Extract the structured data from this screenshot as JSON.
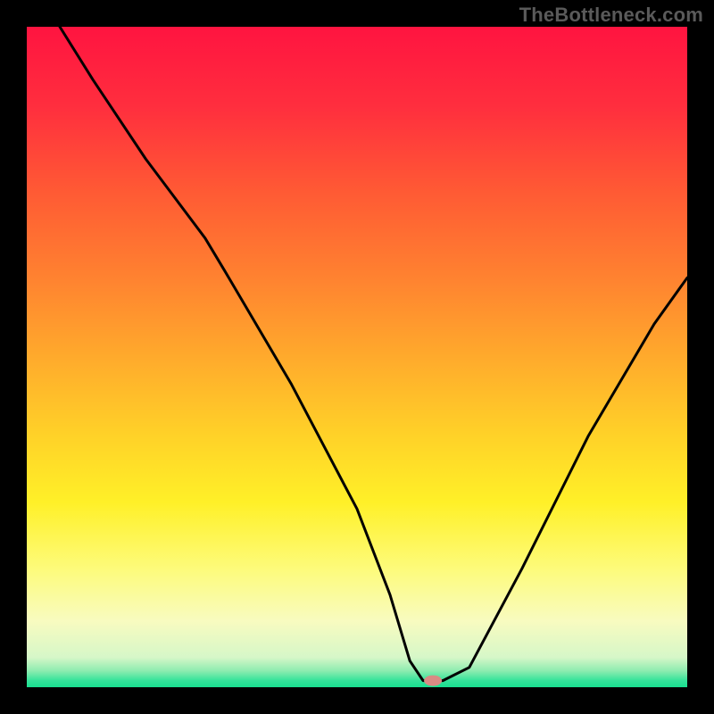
{
  "watermark": "TheBottleneck.com",
  "chart_data": {
    "type": "line",
    "title": "",
    "xlabel": "",
    "ylabel": "",
    "xlim": [
      0,
      100
    ],
    "ylim": [
      0,
      100
    ],
    "grid": false,
    "legend": false,
    "background_gradient": {
      "stops": [
        {
          "offset": 0.0,
          "color": "#ff1440"
        },
        {
          "offset": 0.12,
          "color": "#ff2e3e"
        },
        {
          "offset": 0.25,
          "color": "#ff5a34"
        },
        {
          "offset": 0.38,
          "color": "#ff8230"
        },
        {
          "offset": 0.5,
          "color": "#ffaa2c"
        },
        {
          "offset": 0.62,
          "color": "#ffd228"
        },
        {
          "offset": 0.72,
          "color": "#fff028"
        },
        {
          "offset": 0.82,
          "color": "#fdfb7a"
        },
        {
          "offset": 0.9,
          "color": "#f8fbc0"
        },
        {
          "offset": 0.955,
          "color": "#d6f7c8"
        },
        {
          "offset": 0.975,
          "color": "#8eecb0"
        },
        {
          "offset": 0.99,
          "color": "#34e39a"
        },
        {
          "offset": 1.0,
          "color": "#18df90"
        }
      ]
    },
    "series": [
      {
        "name": "bottleneck-curve",
        "color": "#000000",
        "x": [
          5,
          10,
          18,
          27,
          30,
          40,
          50,
          55,
          58,
          60,
          63,
          67,
          75,
          85,
          95,
          100
        ],
        "y": [
          100,
          92,
          80,
          68,
          63,
          46,
          27,
          14,
          4,
          1,
          1,
          3,
          18,
          38,
          55,
          62
        ]
      }
    ],
    "marker": {
      "name": "optimal-point",
      "x": 61.5,
      "y": 1,
      "color": "#d98b84",
      "rx": 10,
      "ry": 6
    }
  }
}
